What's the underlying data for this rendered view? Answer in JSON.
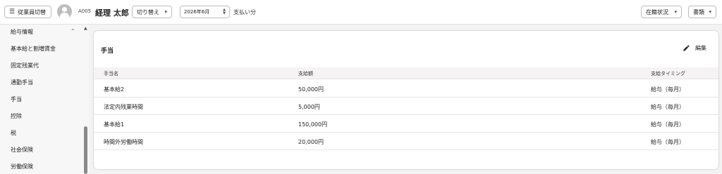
{
  "header": {
    "switch_employee_label": "従業員切替",
    "employee_code": "A005",
    "employee_name": "経理 太郎",
    "toggle_label": "切り替え",
    "month_value": "2026年6月",
    "page_title": "支払い分",
    "status_label": "在籍状況",
    "documents_label": "書類"
  },
  "sidebar": {
    "items": [
      {
        "label": "給与情報"
      },
      {
        "label": "基本給と割増賃金"
      },
      {
        "label": "固定残業代"
      },
      {
        "label": "通勤手当"
      },
      {
        "label": "手当"
      },
      {
        "label": "控除"
      },
      {
        "label": "税"
      },
      {
        "label": "社会保険"
      },
      {
        "label": "労働保険"
      }
    ]
  },
  "card": {
    "title": "手当",
    "edit_label": "編集",
    "columns": [
      "手当名",
      "支給額",
      "支給タイミング"
    ],
    "rows": [
      [
        "基本給2",
        "50,000円",
        "給与（毎月）"
      ],
      [
        "法定内残業時間",
        "5,000円",
        "給与（毎月）"
      ],
      [
        "基本給1",
        "150,000円",
        "給与（毎月）"
      ],
      [
        "時間外労働時間",
        "20,000円",
        "給与（毎月）"
      ]
    ]
  },
  "icons": {
    "menu": "menu-collapse-icon",
    "avatar": "person-avatar-icon",
    "caret": "caret-down-icon",
    "stepper": "stepper-icon",
    "collapse": "chevron-up-icon",
    "edit": "pencil-icon"
  }
}
